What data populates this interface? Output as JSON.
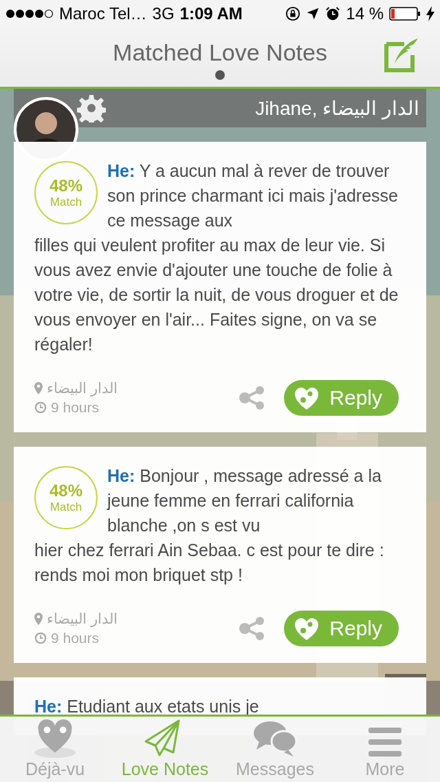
{
  "status_bar": {
    "carrier": "Maroc Tel…",
    "network": "3G",
    "time": "1:09 AM",
    "battery": "14 %"
  },
  "header": {
    "title": "Matched Love Notes",
    "pages": [
      {
        "selected": true
      }
    ]
  },
  "profile": {
    "name": "Jihane, الدار البيضاء"
  },
  "notes": [
    {
      "match": "48%",
      "match_label": "Match",
      "author": "He:",
      "text": "Y a aucun mal à rever de trouver son prince charmant ici mais j'adresse ce message aux",
      "text_continued": "filles qui veulent profiter au max de leur vie. Si vous avez envie d'ajouter une touche de folie à votre vie, de sortir la nuit, de vous droguer et de vous envoyer en l'air... Faites signe, on va se régaler!",
      "location": "الدار البيضاء",
      "time": "9 hours",
      "reply": "Reply"
    },
    {
      "match": "48%",
      "match_label": "Match",
      "author": "He:",
      "text": "Bonjour , message adressé a la jeune femme en ferrari california blanche ,on s est vu",
      "text_continued": "hier chez ferrari Ain Sebaa. c est pour te dire : rends moi mon briquet  stp !",
      "location": "الدار البيضاء",
      "time": "9 hours",
      "reply": "Reply"
    },
    {
      "author": "He:",
      "text": "Etudiant aux etats unis je"
    }
  ],
  "tabs": [
    {
      "label": "Déjà-vu",
      "selected": false
    },
    {
      "label": "Love Notes",
      "selected": true
    },
    {
      "label": "Messages",
      "selected": false
    },
    {
      "label": "More",
      "selected": false
    }
  ]
}
